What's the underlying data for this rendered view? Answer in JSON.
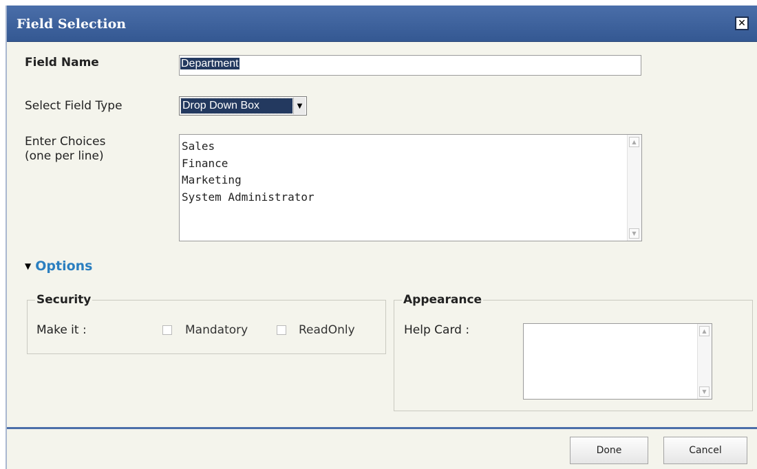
{
  "dialog": {
    "title": "Field Selection",
    "close_glyph": "✕",
    "close_icon": "close-icon"
  },
  "form": {
    "field_name_label": "Field Name",
    "field_name_value": "Department",
    "field_type_label": "Select Field Type",
    "field_type_value": "Drop Down Box",
    "choices_label_line1": "Enter Choices",
    "choices_label_line2": "(one per line)",
    "choices": [
      "Sales",
      "Finance",
      "Marketing",
      "System Administrator"
    ]
  },
  "options": {
    "toggle_label": "Options",
    "security": {
      "legend": "Security",
      "make_it_label": "Make it :",
      "mandatory_label": "Mandatory",
      "readonly_label": "ReadOnly",
      "mandatory_checked": false,
      "readonly_checked": false
    },
    "appearance": {
      "legend": "Appearance",
      "help_card_label": "Help Card :"
    }
  },
  "footer": {
    "done_label": "Done",
    "cancel_label": "Cancel"
  },
  "colors": {
    "titlebar": "#3d62a0",
    "accent_link": "#2b7fc0",
    "selection": "#23395f",
    "background": "#f4f4ec"
  }
}
